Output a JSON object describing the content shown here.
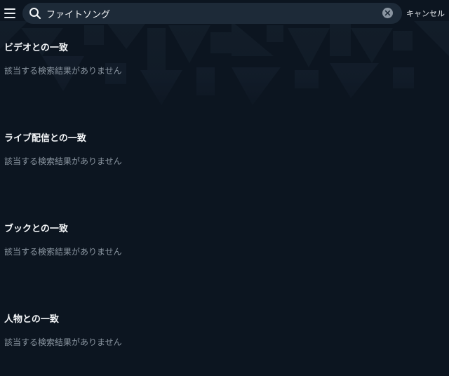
{
  "search": {
    "query": "ファイトソング",
    "cancel_label": "キャンセル"
  },
  "sections": [
    {
      "title": "ビデオとの一致",
      "empty_text": "該当する検索結果がありません"
    },
    {
      "title": "ライブ配信との一致",
      "empty_text": "該当する検索結果がありません"
    },
    {
      "title": "ブックとの一致",
      "empty_text": "該当する検索結果がありません"
    },
    {
      "title": "人物との一致",
      "empty_text": "該当する検索結果がありません"
    }
  ],
  "icons": {
    "menu": "hamburger-menu-icon",
    "search": "search-icon",
    "clear": "clear-circle-x-icon"
  },
  "colors": {
    "background": "#0c1520",
    "search_box": "#1d2a38",
    "heading": "#f5f7f9",
    "muted": "#8b96a1"
  }
}
